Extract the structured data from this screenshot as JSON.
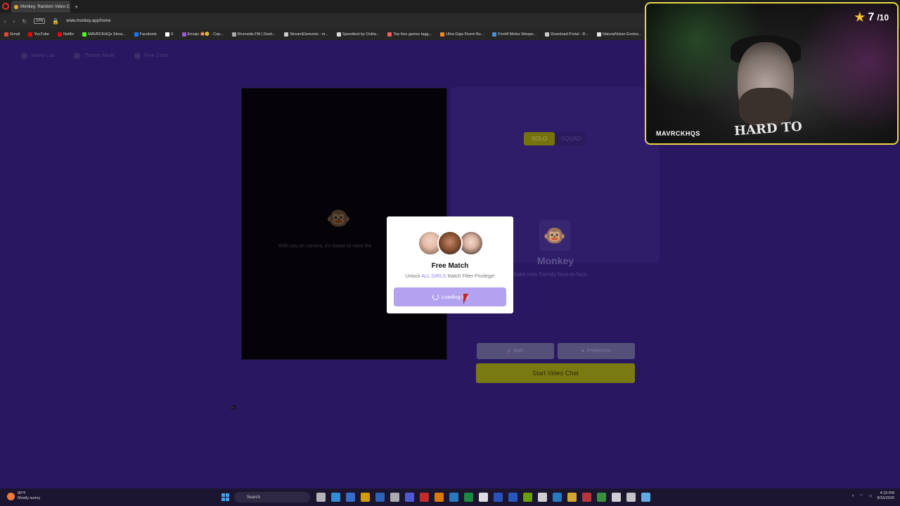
{
  "browser": {
    "tab_title": "Monkey: Random Video C",
    "new_tab_icon": "plus",
    "vpn_label": "VPN",
    "url": "www.monkey.app/home",
    "bookmarks": [
      {
        "label": "Gmail",
        "color": "#ea4335"
      },
      {
        "label": "YouTube",
        "color": "#ff0000"
      },
      {
        "label": "Netflix",
        "color": "#e50914"
      },
      {
        "label": "MAVRCKHQs Strea...",
        "color": "#53fc18"
      },
      {
        "label": "Facebook",
        "color": "#1877f2"
      },
      {
        "label": "X",
        "color": "#ffffff"
      },
      {
        "label": "Emojis 🎇😊 - Cop...",
        "color": "#9a59d1"
      },
      {
        "label": "Riverside.FM | Dash...",
        "color": "#aaaaaa"
      },
      {
        "label": "StreamElements - m...",
        "color": "#cccccc"
      },
      {
        "label": "Speedtest by Ookla...",
        "color": "#dddddd"
      },
      {
        "label": "Top free games tagg...",
        "color": "#fa5c5c"
      },
      {
        "label": "Ultra Giga Fivem Bu...",
        "color": "#f08a24"
      },
      {
        "label": "FiveM Melee Weapo...",
        "color": "#4a90e2"
      },
      {
        "label": "Download Portal - R...",
        "color": "#cccccc"
      },
      {
        "label": "NaturalVision Evolve...",
        "color": "#e8e8e8"
      }
    ]
  },
  "page": {
    "nav": [
      "Safety Lab",
      "Theater Mode",
      "Free Coins"
    ],
    "camera_hint": "With you on camera, it's easier to meet the",
    "mode_toggle": {
      "solo": "SOLO",
      "squad": "SQUAD"
    },
    "brand_title": "Monkey",
    "brand_subtitle": "Make new friends face-to-face",
    "filter_both": "Both",
    "filter_preference": "Preference",
    "start_button": "Start Video Chat",
    "ad_badge": "Ad"
  },
  "modal": {
    "title": "Free Match",
    "subtitle_pre": "Unlock ",
    "subtitle_highlight": "ALL GIRLS",
    "subtitle_post": " Match Filter Privilege!",
    "button_label": "Loading ad"
  },
  "overlay": {
    "rating": "7",
    "rating_max": "/10",
    "handle": "MAVRCKHQS",
    "shirt_text": "HARD TO"
  },
  "taskbar": {
    "temperature": "90°F",
    "weather": "Mostly sunny",
    "search_placeholder": "Search",
    "time": "4:19 PM",
    "date": "8/16/2026",
    "accent": "#3aa3f2"
  },
  "colors": {
    "page_bg": "#2a1762",
    "start_button": "#7a7a12",
    "modal_button": "#b2a2ef",
    "highlight": "#8e77f0",
    "overlay_border": "#e7d84a"
  }
}
